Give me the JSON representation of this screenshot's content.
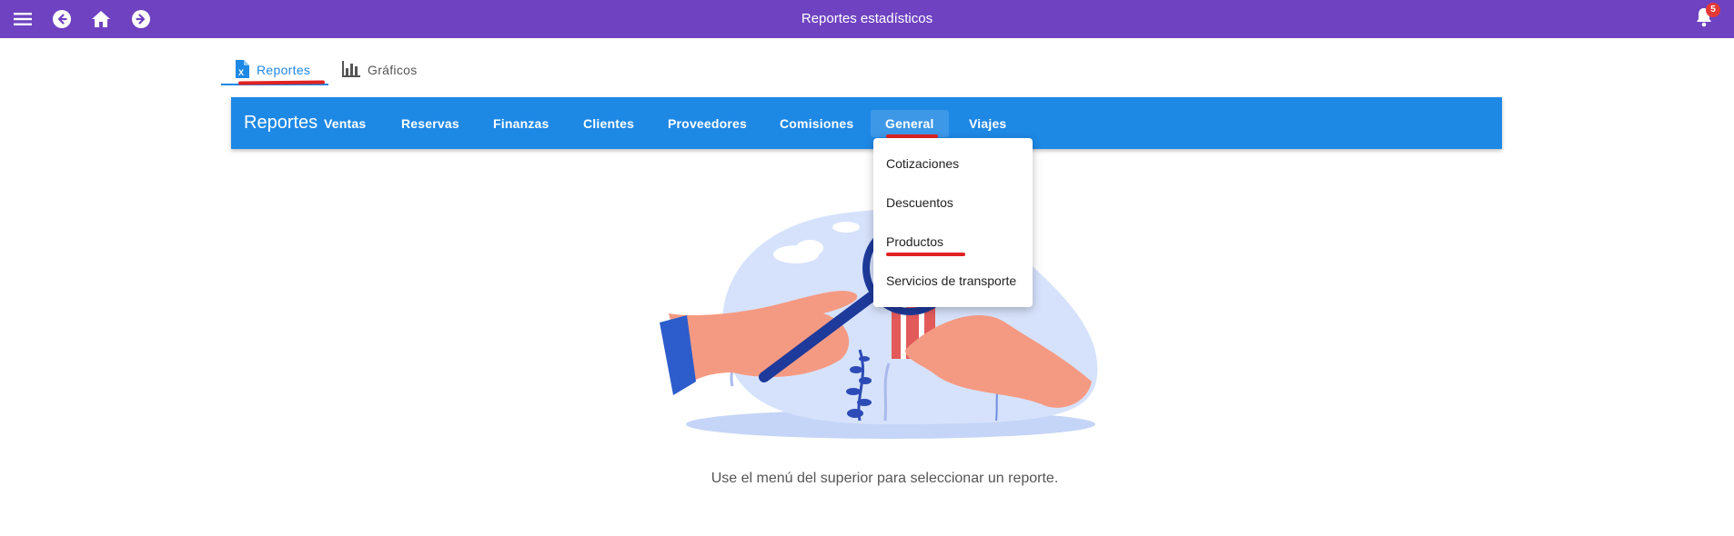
{
  "appbar": {
    "title": "Reportes estadísticos",
    "notification_count": "5",
    "color": "#6f42c1",
    "icons": [
      "menu-icon",
      "back-icon",
      "home-icon",
      "forward-icon",
      "bell-icon"
    ]
  },
  "tabs": [
    {
      "label": "Reportes",
      "icon": "excel-file-icon",
      "active": true
    },
    {
      "label": "Gráficos",
      "icon": "bar-chart-icon",
      "active": false
    }
  ],
  "toolbar": {
    "title": "Reportes",
    "color": "#1e88e5",
    "menu": [
      {
        "label": "Ventas"
      },
      {
        "label": "Reservas"
      },
      {
        "label": "Finanzas"
      },
      {
        "label": "Clientes"
      },
      {
        "label": "Proveedores"
      },
      {
        "label": "Comisiones"
      },
      {
        "label": "General",
        "active": true
      },
      {
        "label": "Viajes"
      }
    ]
  },
  "dropdown": {
    "items": [
      {
        "label": "Cotizaciones"
      },
      {
        "label": "Descuentos"
      },
      {
        "label": "Productos"
      },
      {
        "label": "Servicios de transporte"
      }
    ]
  },
  "main": {
    "empty_message": "Use el menú del superior para seleccionar un reporte."
  }
}
